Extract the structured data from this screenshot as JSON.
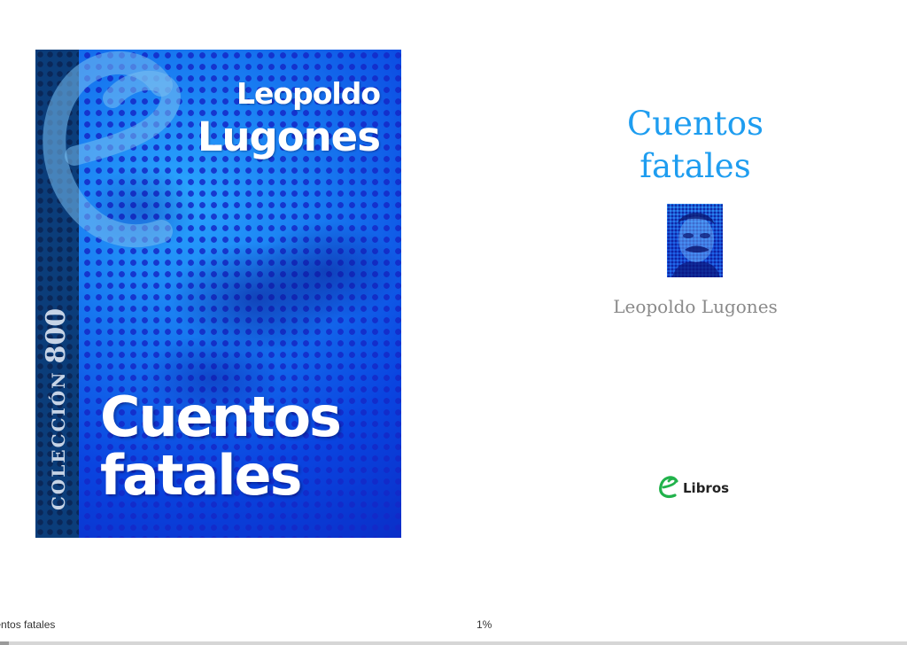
{
  "cover": {
    "author_first": "Leopoldo",
    "author_last": "Lugones",
    "title_line1": "Cuentos",
    "title_line2": "fatales",
    "series_label": "COLECCIÓN",
    "series_number": "800"
  },
  "title_page": {
    "title_line1": "Cuentos",
    "title_line2": "fatales",
    "author": "Leopoldo Lugones",
    "publisher": "Libros",
    "title_color": "#1e9df0"
  },
  "status_bar": {
    "chapter": "Cuentos fatales",
    "progress_label": "1%",
    "progress_fraction": 0.01
  }
}
